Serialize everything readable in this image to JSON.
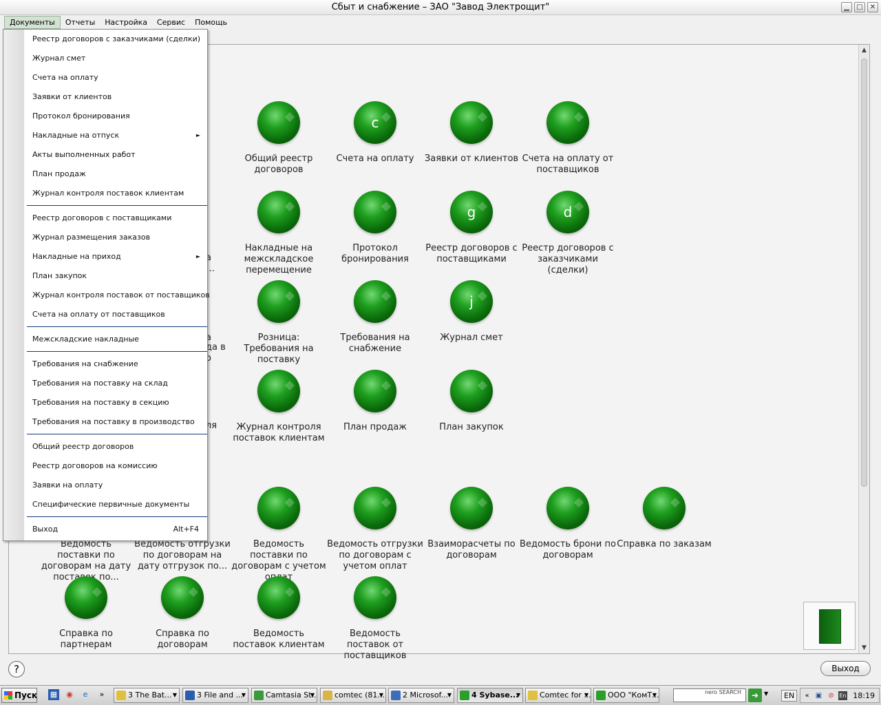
{
  "window": {
    "title": "Сбыт и снабжение – ЗАО \"Завод  Электрощит\"",
    "controls": [
      "minimize-icon",
      "maximize-icon",
      "close-icon"
    ]
  },
  "menubar": {
    "items": [
      "Документы",
      "Отчеты",
      "Настройка",
      "Сервис",
      "Помощь"
    ]
  },
  "dropdown": {
    "groups": [
      [
        "Реестр договоров с заказчиками (сделки)",
        "Журнал смет",
        "Счета на оплату",
        "Заявки от клиентов",
        "Протокол бронирования",
        "Накладные на отпуск",
        "Акты выполненных работ",
        "План продаж",
        "Журнал контроля поставок клиентам"
      ],
      [
        "Реестр договоров с поставщиками",
        "Журнал размещения заказов",
        "Накладные на приход",
        "План закупок",
        "Журнал контроля поставок от поставщиков",
        "Счета на оплату от поставщиков"
      ],
      [
        "Межскладские накладные"
      ],
      [
        "Требования на снабжение",
        "Требования на поставку на склад",
        "Требования на поставку в секцию",
        "Требования на поставку в производство"
      ],
      [
        "Общий реестр договоров",
        "Реестр договоров на комиссию",
        "Заявки на оплату",
        "Специфические первичные документы"
      ],
      [
        "Выход"
      ]
    ],
    "submenu_items": [
      "Накладные на отпуск",
      "Накладные на приход"
    ],
    "exit_shortcut": "Alt+F4"
  },
  "tiles": [
    {
      "label": "Общий реестр договоров",
      "glyph": ""
    },
    {
      "label": "Счета на оплату",
      "glyph": "c"
    },
    {
      "label": "Заявки от клиентов",
      "glyph": ""
    },
    {
      "label": "Счета на оплату от поставщиков",
      "glyph": ""
    },
    {
      "label": "Накладные на межскладское перемещение",
      "glyph": ""
    },
    {
      "label": "Протокол бронирования",
      "glyph": ""
    },
    {
      "label": "Реестр договоров с поставщиками",
      "glyph": "g"
    },
    {
      "label": "Реестр договоров с заказчиками (сделки)",
      "glyph": "d"
    },
    {
      "label": "Розница: Требования на поставку",
      "glyph": ""
    },
    {
      "label": "Требования на снабжение",
      "glyph": ""
    },
    {
      "label": "Журнал смет",
      "glyph": "j"
    },
    {
      "label": "Журнал контроля поставок клиентам",
      "glyph": ""
    },
    {
      "label": "План продаж",
      "glyph": ""
    },
    {
      "label": "План закупок",
      "glyph": ""
    },
    {
      "label": "Ведомость поставки по договорам на дату поставок по...",
      "glyph": ""
    },
    {
      "label": "Ведомость отгрузки по договорам на дату отгрузок по...",
      "glyph": ""
    },
    {
      "label": "Ведомость поставки по договорам с учетом оплат",
      "glyph": ""
    },
    {
      "label": "Ведомость отгрузки по договорам с учетом оплат",
      "glyph": ""
    },
    {
      "label": "Взаиморасчеты по договорам",
      "glyph": ""
    },
    {
      "label": "Ведомость брони по договорам",
      "glyph": ""
    },
    {
      "label": "Справка по заказам",
      "glyph": ""
    },
    {
      "label": "Справка по партнерам",
      "glyph": ""
    },
    {
      "label": "Справка по договорам",
      "glyph": ""
    },
    {
      "label": "Ведомость поставок клиентам",
      "glyph": ""
    },
    {
      "label": "Ведомость поставок от поставщиков",
      "glyph": ""
    }
  ],
  "hidden_fragments": [
    "а",
    "…",
    "а",
    "да в",
    "о",
    "ля"
  ],
  "bottom": {
    "help": "?",
    "exit": "Выход"
  },
  "taskbar": {
    "start": "Пуск",
    "tasks": [
      "3 The Bat...",
      "3 File and ...",
      "Camtasia St...",
      "comtec (81....",
      "2 Microsof...",
      "4 Sybase...",
      "Comtec for ...",
      "ООО \"КомТ..."
    ],
    "active_task": "4 Sybase...",
    "nero": "nero SEARCH",
    "lang": "EN",
    "clock": "18:19"
  },
  "colors": {
    "accent_green": "#1f9f1f",
    "separator": "#123a78"
  }
}
